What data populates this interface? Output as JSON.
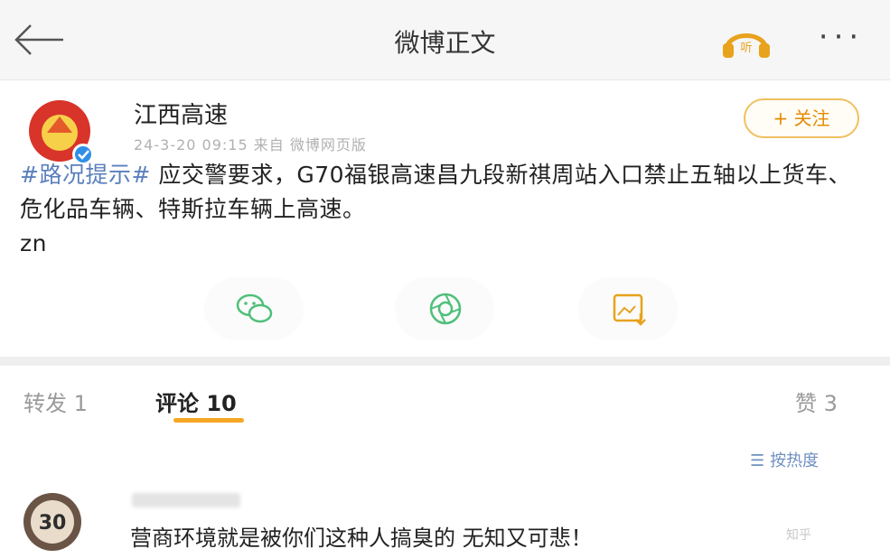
{
  "header": {
    "title": "微博正文",
    "listen_label": "听",
    "more_label": "···"
  },
  "post": {
    "author": "江西高速",
    "meta": "24-3-20 09:15  来自 微博网页版",
    "follow_label": "+ 关注",
    "hashtag": "#路况提示#",
    "text": " 应交警要求，G70福银高速昌九段新祺周站入口禁止五轴以上货车、危化品车辆、特斯拉车辆上高速。",
    "sign": "zn",
    "share_icons": [
      "wechat-icon",
      "moments-icon",
      "image-save-icon"
    ]
  },
  "tabs": {
    "repost": "转发 1",
    "comment": "评论 10",
    "like": "赞 3"
  },
  "comments": {
    "sort_label": "按热度",
    "items": [
      {
        "badge": "30",
        "text": "营商环境就是被你们这种人搞臭的 无知又可悲！"
      }
    ]
  },
  "watermark": "知乎",
  "colors": {
    "accent": "#f5a623",
    "link": "#5a7fbd",
    "follow": "#e58a00"
  }
}
